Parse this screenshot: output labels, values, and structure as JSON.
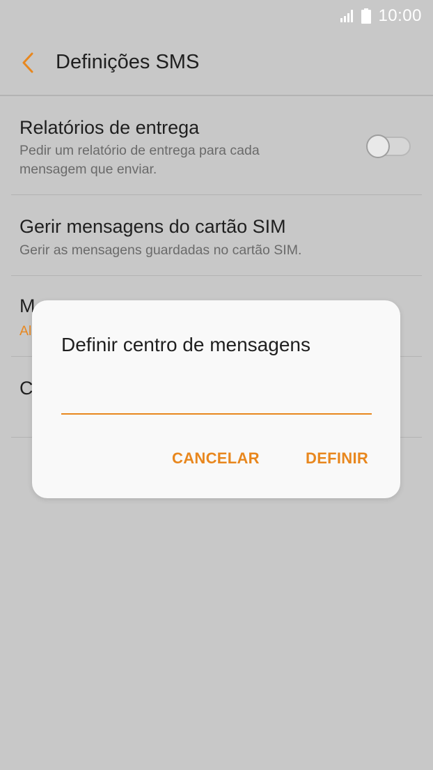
{
  "status_bar": {
    "time": "10:00",
    "signal_icon": "signal-icon",
    "battery_icon": "battery-icon"
  },
  "header": {
    "back_icon": "chevron-left-icon",
    "title": "Definições SMS"
  },
  "settings": {
    "delivery_reports": {
      "title": "Relatórios de entrega",
      "subtitle_line1": "Pedir um relatório de entrega para cada",
      "subtitle_line2": "mensagem que enviar.",
      "enabled": false
    },
    "sim_messages": {
      "title": "Gerir mensagens do cartão SIM",
      "subtitle": "Gerir as mensagens guardadas no cartão SIM."
    },
    "input_mode": {
      "title_visible": "M",
      "subtitle_visible": "Al"
    },
    "message_center": {
      "title_visible": "C"
    }
  },
  "dialog": {
    "title": "Definir centro de mensagens",
    "input_value": "",
    "cancel_label": "CANCELAR",
    "define_label": "DEFINIR"
  },
  "colors": {
    "accent": "#e8871e",
    "background_dim": "#c8c8c8",
    "dialog_bg": "#f9f9f9"
  }
}
